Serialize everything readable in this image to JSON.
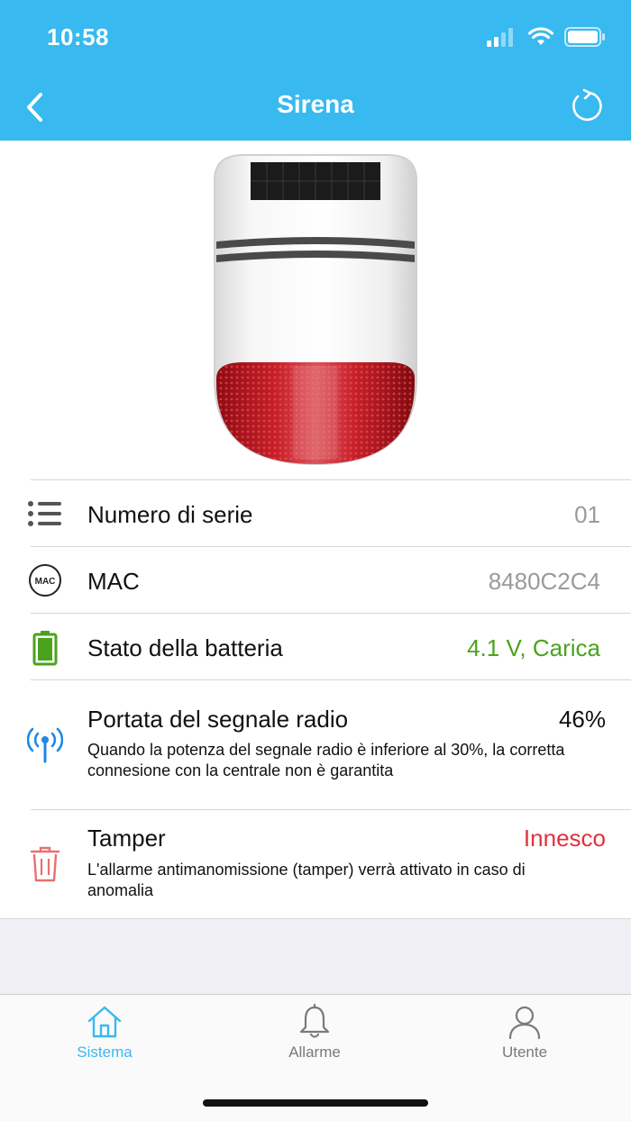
{
  "status_bar": {
    "time": "10:58"
  },
  "nav": {
    "title": "Sirena",
    "back_icon": "chevron-left-icon",
    "refresh_icon": "refresh-icon"
  },
  "device": {
    "image": "siren-device-illustration"
  },
  "info_rows": [
    {
      "icon": "list-icon",
      "label": "Numero di serie",
      "value": "01",
      "value_color": "#9a9a9a"
    },
    {
      "icon": "mac-icon",
      "icon_text": "MAC",
      "label": "MAC",
      "value": "8480C2C4",
      "value_color": "#9a9a9a"
    },
    {
      "icon": "battery-icon",
      "label": "Stato della batteria",
      "value": "4.1 V, Carica",
      "value_color": "#4aa31c"
    },
    {
      "icon": "signal-antenna-icon",
      "label": "Portata del segnale radio",
      "value": "46%",
      "value_color": "#111111",
      "description": "Quando la potenza del segnale radio è inferiore al 30%, la corretta connesione con la centrale non è garantita"
    },
    {
      "icon": "trash-icon",
      "label": "Tamper",
      "value": "Innesco",
      "value_color": "#e0323c",
      "description": "L'allarme antimanomissione (tamper) verrà attivato in caso di anomalia"
    }
  ],
  "tabbar": {
    "active_color": "#38b9ef",
    "inactive_color": "#7a7a7a",
    "tabs": [
      {
        "icon": "home-icon",
        "label": "Sistema",
        "active": true
      },
      {
        "icon": "bell-icon",
        "label": "Allarme",
        "active": false
      },
      {
        "icon": "user-icon",
        "label": "Utente",
        "active": false
      }
    ]
  }
}
